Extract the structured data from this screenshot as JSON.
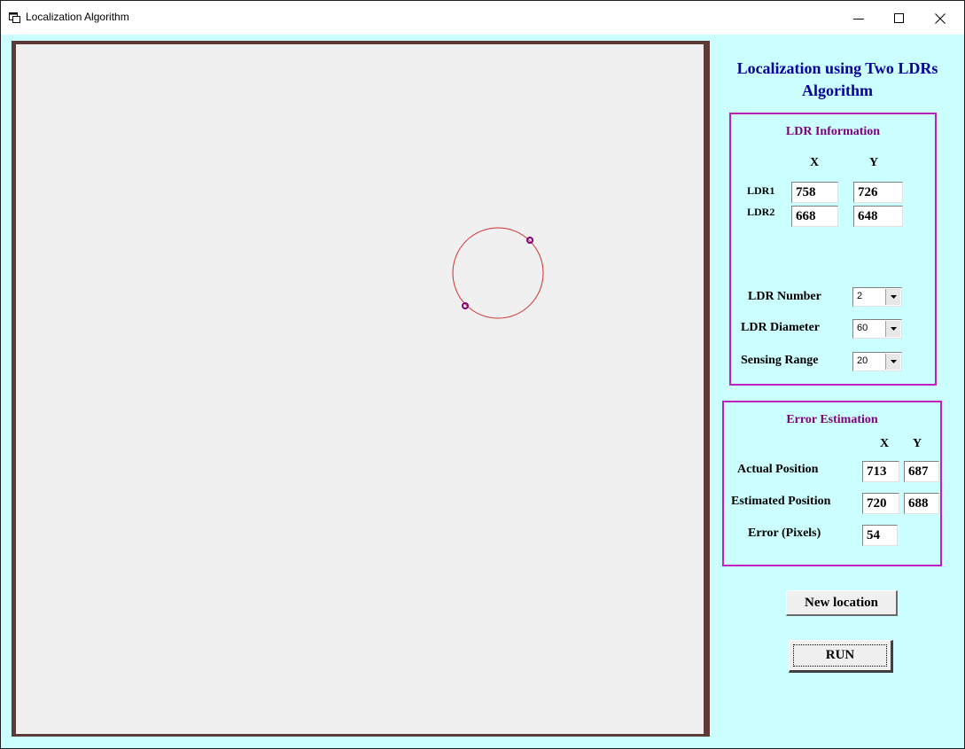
{
  "window": {
    "title": "Localization Algorithm",
    "controls": [
      "minimize-icon",
      "maximize-icon",
      "close-icon"
    ]
  },
  "colors": {
    "panel_bg": "#ccffff",
    "canvas_bg": "#f0f0f0",
    "canvas_border": "#5e3a36",
    "heading": "#0000a0",
    "group_border": "#c020c0",
    "group_title": "#800080",
    "circle": "#d03030",
    "ldr_marker": "#800080"
  },
  "panel": {
    "title_line1": "Localization using Two LDRs",
    "title_line2": "Algorithm"
  },
  "ldr_info": {
    "title": "LDR Information",
    "col_x": "X",
    "col_y": "Y",
    "ldr1_label": "LDR1",
    "ldr1_x": "758",
    "ldr1_y": "726",
    "ldr2_label": "LDR2",
    "ldr2_x": "668",
    "ldr2_y": "648",
    "ldr_number_label": "LDR Number",
    "ldr_number_value": "2",
    "ldr_diameter_label": "LDR Diameter",
    "ldr_diameter_value": "60",
    "sensing_range_label": "Sensing Range",
    "sensing_range_value": "20"
  },
  "error_estimation": {
    "title": "Error Estimation",
    "col_x": "X",
    "col_y": "Y",
    "actual_label": "Actual Position",
    "actual_x": "713",
    "actual_y": "687",
    "estimated_label": "Estimated Position",
    "estimated_x": "720",
    "estimated_y": "688",
    "error_label": "Error (Pixels)",
    "error_value": "54"
  },
  "buttons": {
    "new_location": "New location",
    "run": "RUN"
  }
}
